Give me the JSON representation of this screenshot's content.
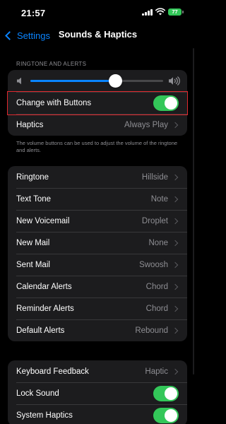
{
  "status_bar": {
    "time": "21:57",
    "battery_level": "77",
    "battery_color": "#33c759"
  },
  "nav": {
    "back_label": "Settings",
    "title": "Sounds & Haptics",
    "accent_color": "#0a84ff"
  },
  "ringtone_section": {
    "header": "RINGTONE AND ALERTS",
    "volume_level": 0.64,
    "change_with_buttons": {
      "label": "Change with Buttons",
      "on": true
    },
    "haptics": {
      "label": "Haptics",
      "value": "Always Play"
    },
    "footnote": "The volume buttons can be used to adjust the volume of the ringtone and alerts."
  },
  "sounds": [
    {
      "label": "Ringtone",
      "value": "Hillside"
    },
    {
      "label": "Text Tone",
      "value": "Note"
    },
    {
      "label": "New Voicemail",
      "value": "Droplet"
    },
    {
      "label": "New Mail",
      "value": "None"
    },
    {
      "label": "Sent Mail",
      "value": "Swoosh"
    },
    {
      "label": "Calendar Alerts",
      "value": "Chord"
    },
    {
      "label": "Reminder Alerts",
      "value": "Chord"
    },
    {
      "label": "Default Alerts",
      "value": "Rebound"
    }
  ],
  "system_section": {
    "keyboard_feedback": {
      "label": "Keyboard Feedback",
      "value": "Haptic"
    },
    "lock_sound": {
      "label": "Lock Sound",
      "on": true
    },
    "system_haptics": {
      "label": "System Haptics",
      "on": true
    }
  },
  "icons": [
    "back-chevron-icon",
    "speaker-low-icon",
    "speaker-high-icon",
    "chevron-right-icon",
    "signal-icon",
    "wifi-icon",
    "battery-icon"
  ]
}
